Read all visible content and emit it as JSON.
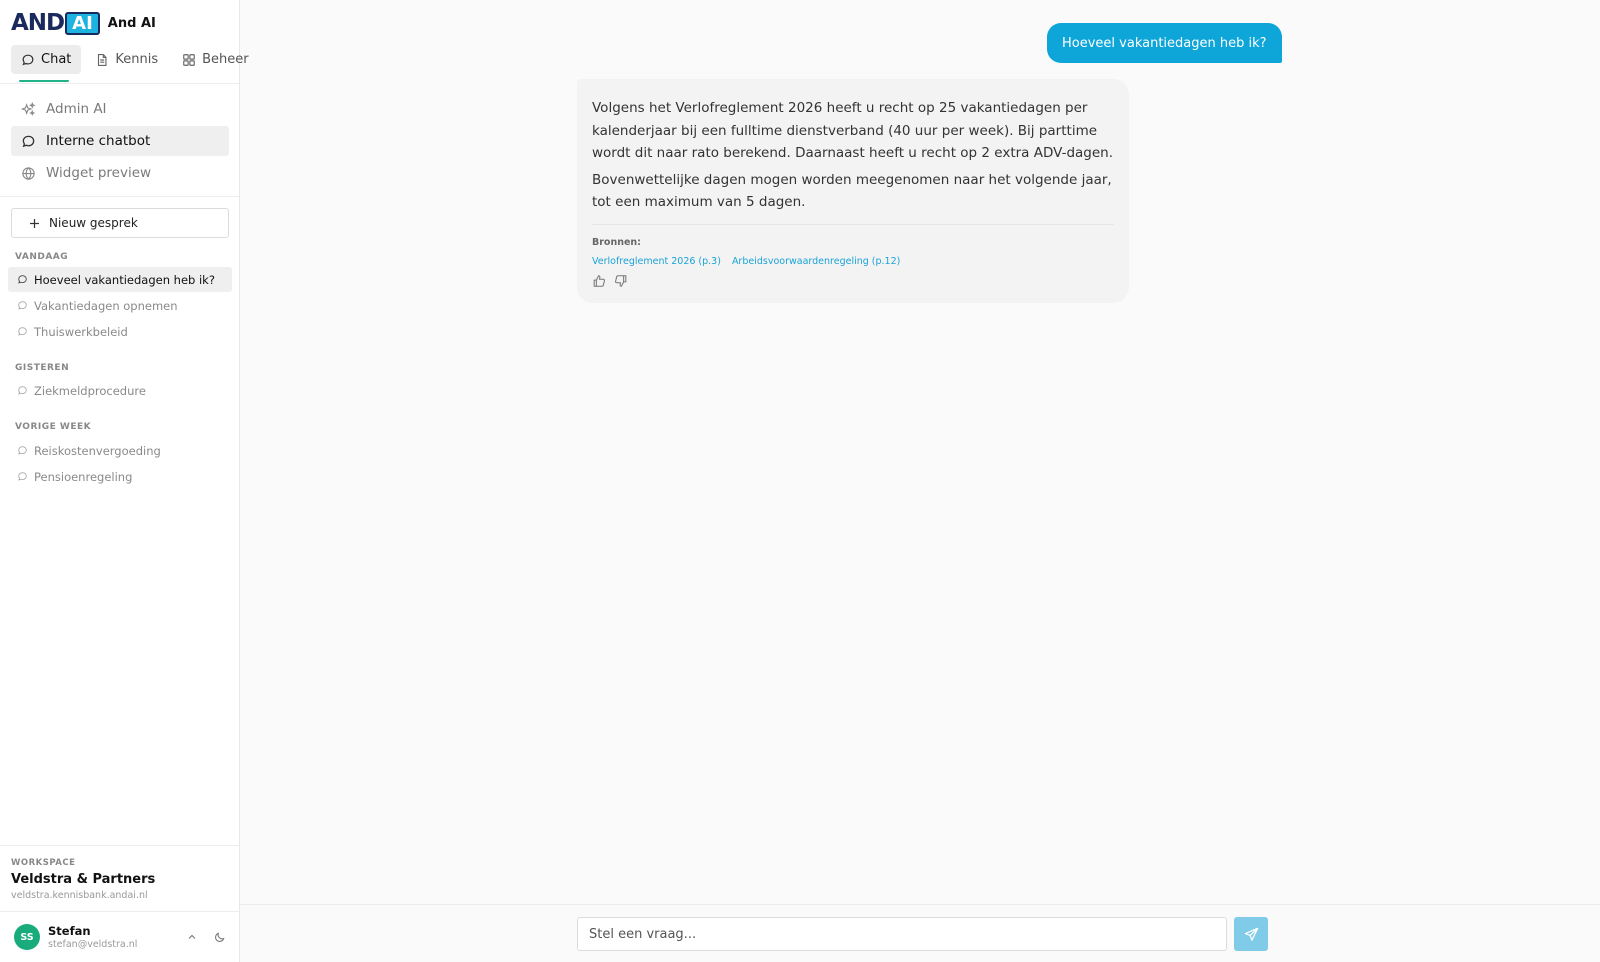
{
  "brand": {
    "logo_and": "AND",
    "logo_ai": "AI",
    "name": "And AI"
  },
  "nav_tabs": [
    {
      "label": "Chat",
      "icon": "chat-bubble-icon",
      "active": true
    },
    {
      "label": "Kennis",
      "icon": "document-icon",
      "active": false
    },
    {
      "label": "Beheer",
      "icon": "grid-icon",
      "active": false
    }
  ],
  "modes": [
    {
      "label": "Admin AI",
      "icon": "sparkle-icon",
      "active": false
    },
    {
      "label": "Interne chatbot",
      "icon": "chat-bubble-icon",
      "active": true
    },
    {
      "label": "Widget preview",
      "icon": "globe-icon",
      "active": false
    }
  ],
  "new_chat_label": "Nieuw gesprek",
  "history": [
    {
      "label": "VANDAAG",
      "items": [
        "Hoeveel vakantiedagen heb ik?",
        "Vakantiedagen opnemen",
        "Thuiswerkbeleid"
      ]
    },
    {
      "label": "GISTEREN",
      "items": [
        "Ziekmeldprocedure"
      ]
    },
    {
      "label": "VORIGE WEEK",
      "items": [
        "Reiskostenvergoeding",
        "Pensioenregeling"
      ]
    }
  ],
  "active_conversation": "Hoeveel vakantiedagen heb ik?",
  "workspace": {
    "label": "WORKSPACE",
    "name": "Veldstra & Partners",
    "domain": "veldstra.kennisbank.andai.nl"
  },
  "user": {
    "initials": "SS",
    "name": "Stefan",
    "email": "stefan@veldstra.nl"
  },
  "chat": {
    "user_message": "Hoeveel vakantiedagen heb ik?",
    "bot_paragraphs": [
      "Volgens het Verlofreglement 2026 heeft u recht op 25 vakantiedagen per kalenderjaar bij een fulltime dienstverband (40 uur per week). Bij parttime wordt dit naar rato berekend. Daarnaast heeft u recht op 2 extra ADV-dagen.",
      "Bovenwettelijke dagen mogen worden meegenomen naar het volgende jaar, tot een maximum van 5 dagen."
    ],
    "sources_label": "Bronnen:",
    "sources": [
      "Verlofreglement 2026 (p.3)",
      "Arbeidsvoorwaardenregeling (p.12)"
    ]
  },
  "composer": {
    "placeholder": "Stel een vraag..."
  },
  "colors": {
    "accent": "#0ea5d8",
    "brand_navy": "#1b2a5c",
    "brand_cyan": "#1cb3e0",
    "avatar": "#1aab7c",
    "tab_underline": "#22b389"
  }
}
